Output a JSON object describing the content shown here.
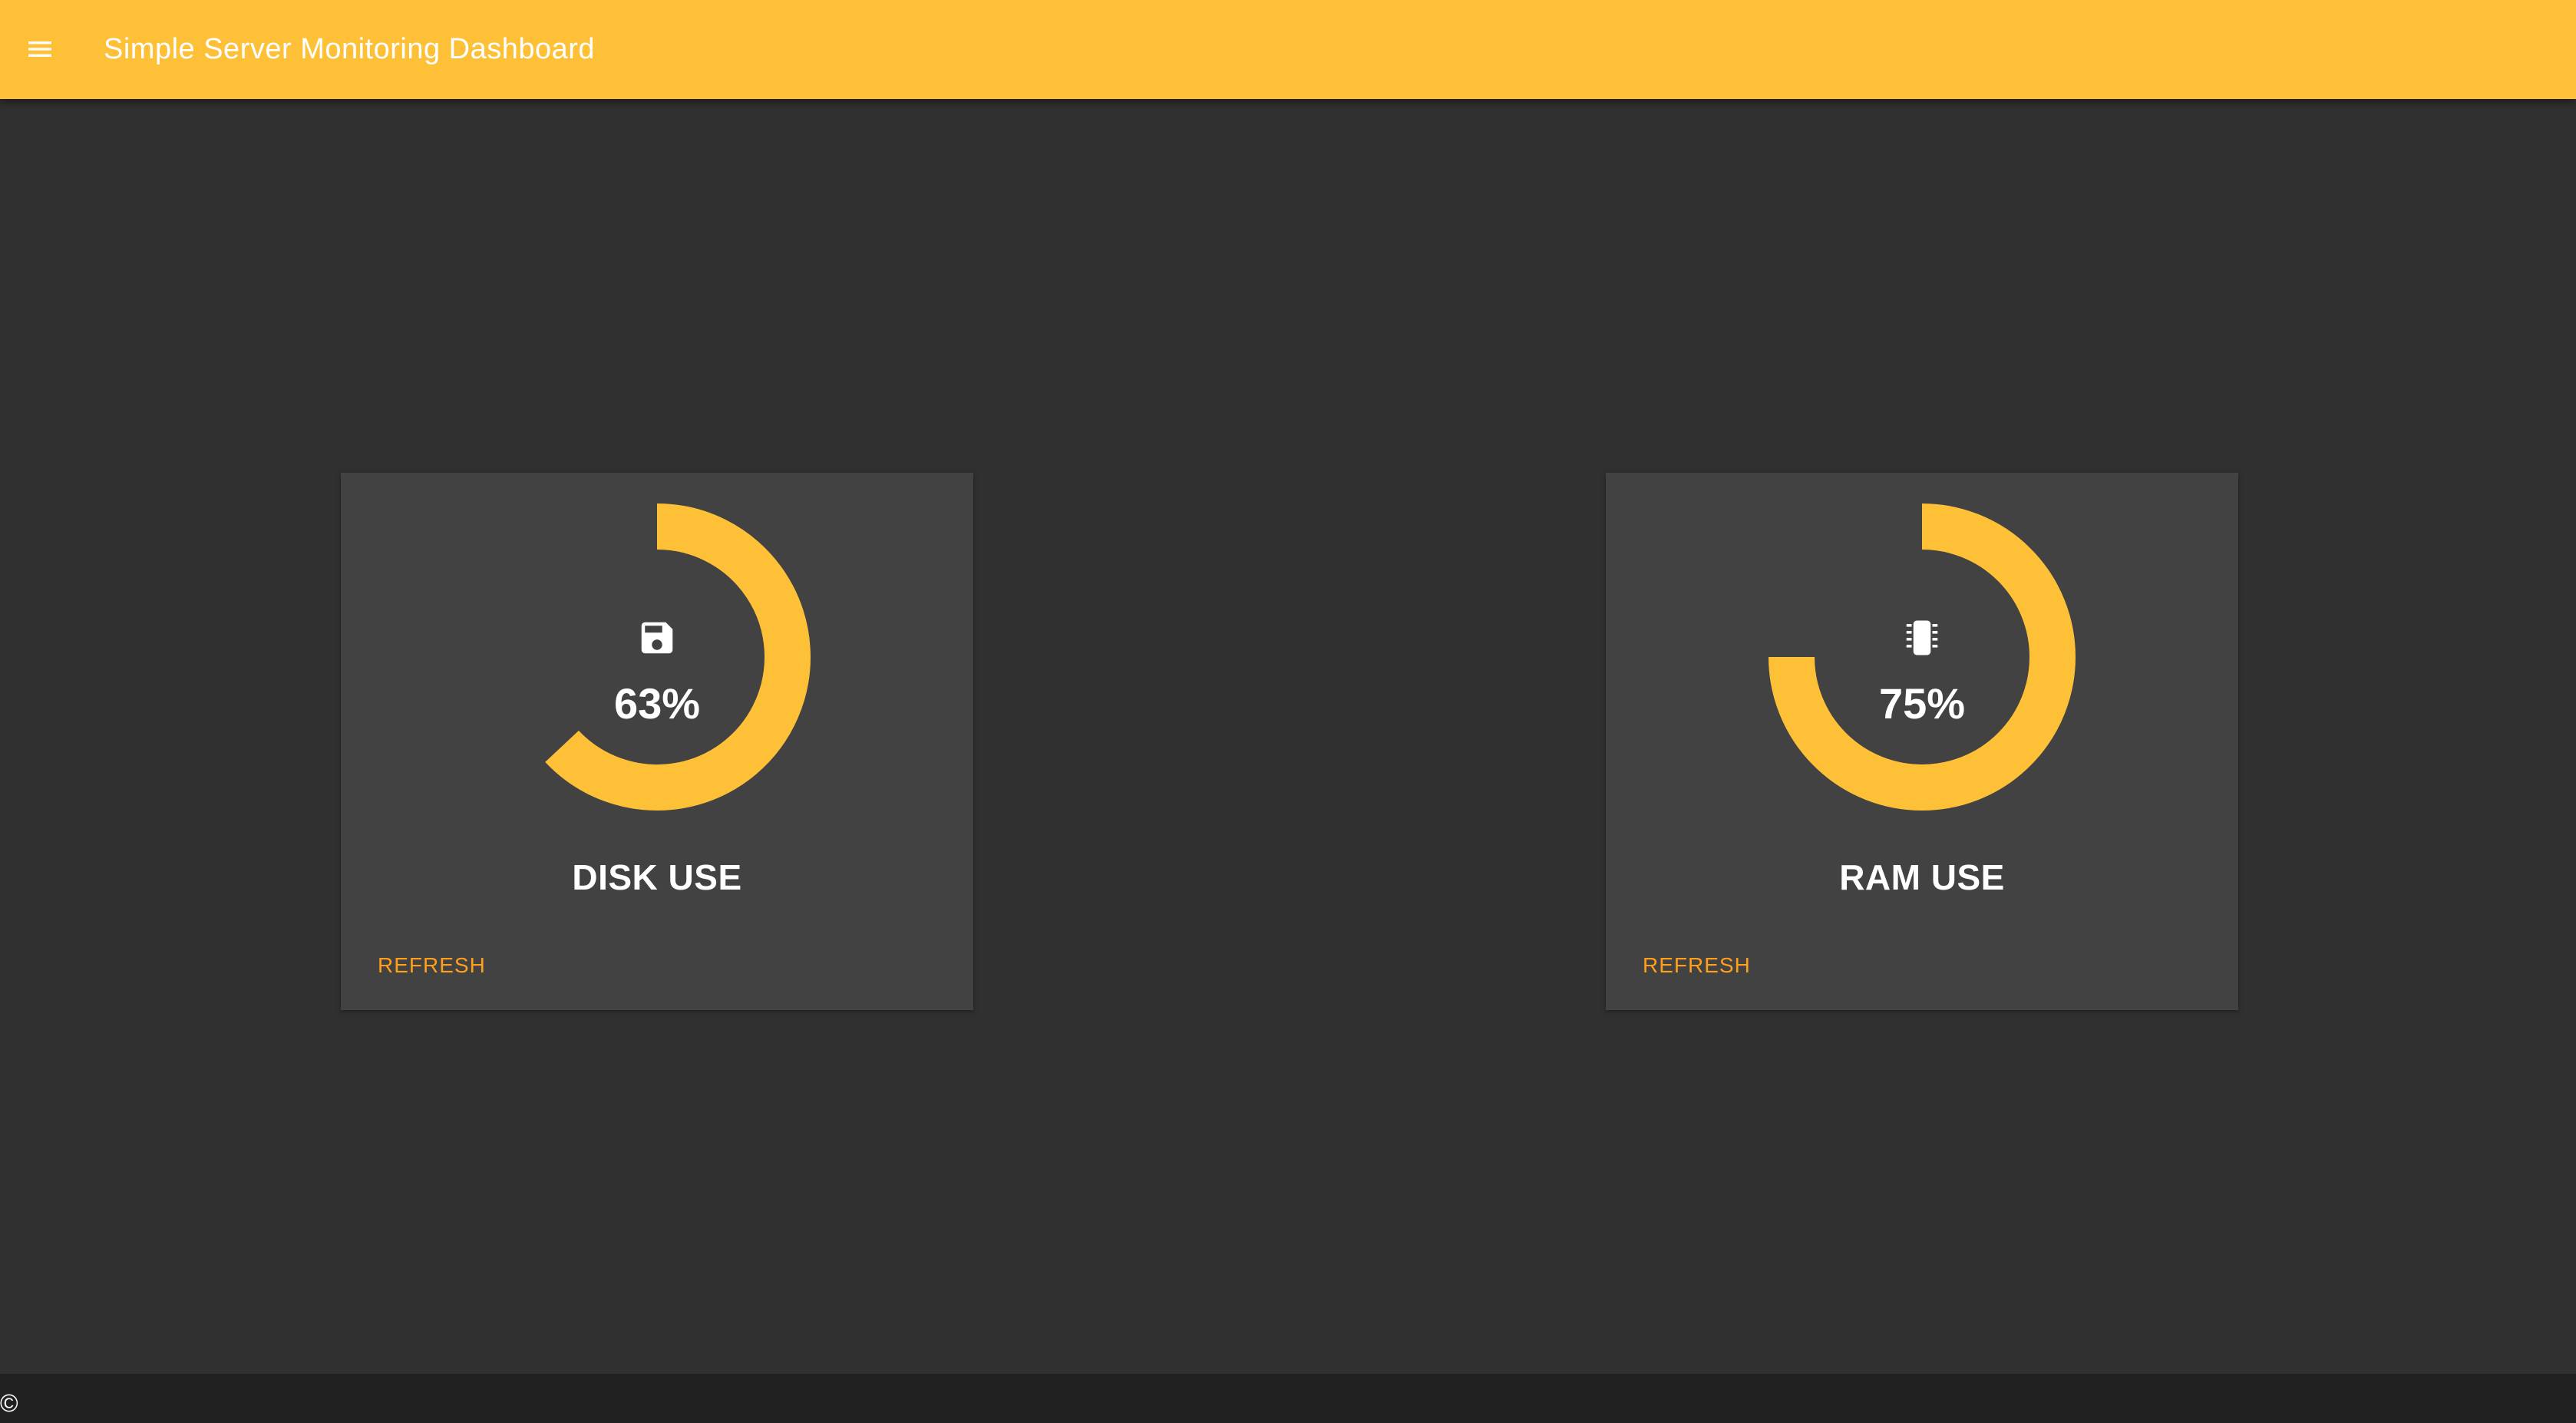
{
  "app_bar": {
    "title": "Simple Server Monitoring Dashboard",
    "menu_icon": "menu-icon",
    "color": "#fdc036"
  },
  "cards": [
    {
      "title": "DISK USE",
      "percent_label": "63%",
      "percent": 63,
      "icon": "floppy-disk-icon",
      "refresh_label": "REFRESH"
    },
    {
      "title": "RAM USE",
      "percent_label": "75%",
      "percent": 75,
      "icon": "memory-chip-icon",
      "refresh_label": "REFRESH"
    }
  ],
  "colors": {
    "gauge": "#fdc036",
    "refresh": "#ff9f1a",
    "card": "#424242",
    "background": "#303030"
  },
  "footer": {
    "text": "©"
  }
}
